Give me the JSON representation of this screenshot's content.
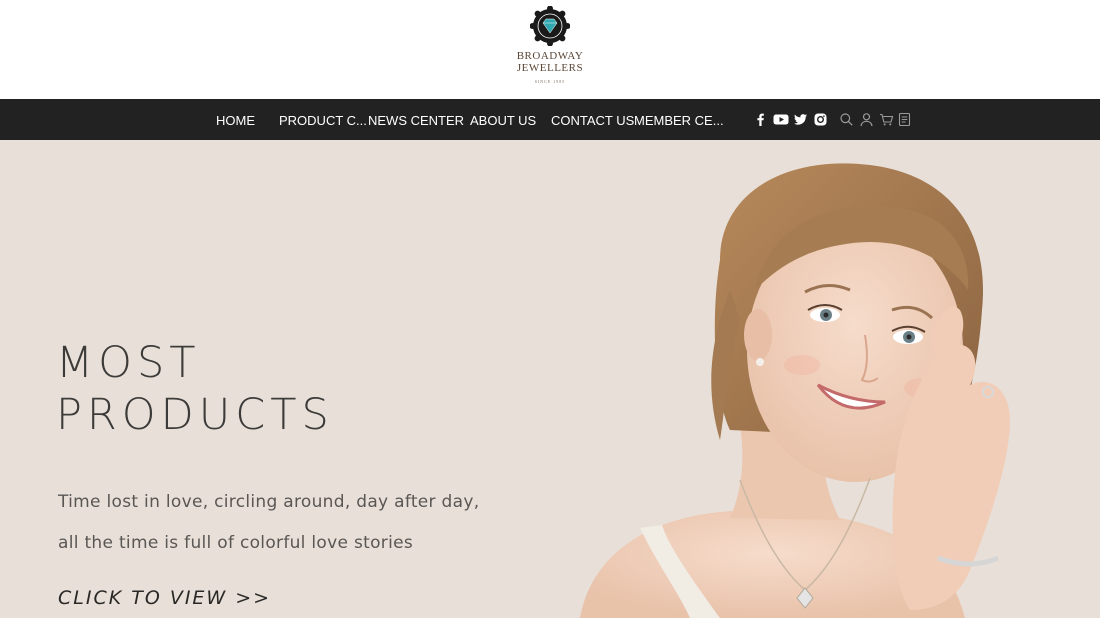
{
  "brand": {
    "name_line1": "BROADWAY",
    "name_line2": "JEWELLERS",
    "since": "SINCE 1985",
    "emblem_color": "#1a1a1a",
    "gem_color": "#2fa8b0"
  },
  "nav": {
    "items": [
      {
        "label": "HOME"
      },
      {
        "label": "PRODUCT C..."
      },
      {
        "label": "NEWS CENTER"
      },
      {
        "label": "ABOUT US"
      },
      {
        "label": "CONTACT US"
      },
      {
        "label": "MEMBER CE..."
      }
    ],
    "social_icons": [
      "facebook-icon",
      "youtube-icon",
      "twitter-icon",
      "instagram-icon"
    ],
    "utility_icons": [
      "search-icon",
      "user-icon",
      "cart-icon",
      "orders-icon"
    ],
    "background": "#222222"
  },
  "hero": {
    "title_line1": "MOST",
    "title_line2": "PRODUCTS",
    "text_line1": "Time lost in love, circling around, day after day,",
    "text_line2": "all the time is full of colorful love stories",
    "cta": "CLICK TO VIEW >>",
    "background": "#e8e0d8"
  }
}
